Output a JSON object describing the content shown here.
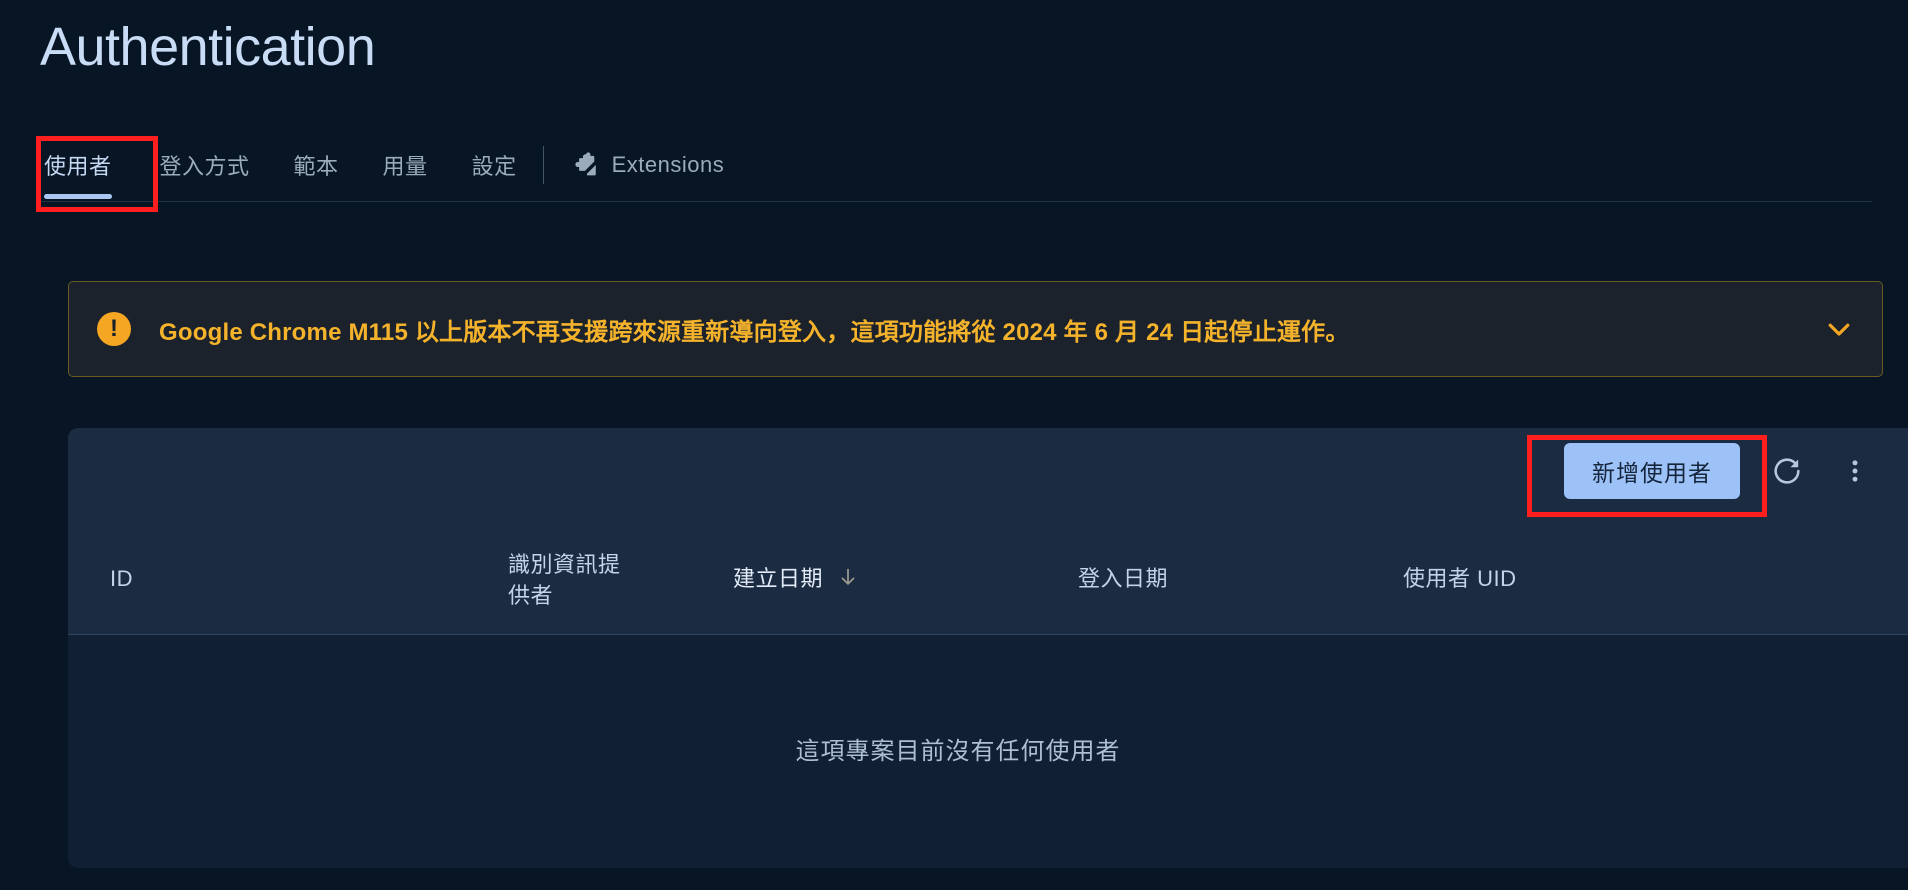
{
  "page": {
    "title": "Authentication",
    "accent_blue": "#9dc2f8",
    "warning_amber": "#f5b32c",
    "annotation_red": "#ff1f1f",
    "background": "#071524",
    "card_background": "#111f33",
    "card_header_background": "#1b2c42"
  },
  "tabs": [
    {
      "label": "使用者",
      "active": true,
      "icon": null
    },
    {
      "label": "登入方式",
      "active": false,
      "icon": null
    },
    {
      "label": "範本",
      "active": false,
      "icon": null
    },
    {
      "label": "用量",
      "active": false,
      "icon": null
    },
    {
      "label": "設定",
      "active": false,
      "icon": null
    },
    {
      "label": "Extensions",
      "active": false,
      "icon": "puzzle-piece-icon"
    }
  ],
  "banner": {
    "icon": "exclamation-circle-icon",
    "icon_glyph": "!",
    "message": "Google Chrome M115 以上版本不再支援跨來源重新導向登入，這項功能將從 2024 年 6 月 24 日起停止運作。",
    "expand_icon": "chevron-down-icon"
  },
  "toolbar": {
    "add_user_label": "新增使用者",
    "refresh_icon": "refresh-icon",
    "more_icon": "more-vert-icon"
  },
  "table": {
    "columns": [
      {
        "key": "id",
        "label": "ID",
        "sortable": false
      },
      {
        "key": "provider",
        "label": "識別資訊提供者",
        "sortable": false
      },
      {
        "key": "created",
        "label": "建立日期",
        "sortable": true,
        "sort_direction": "desc",
        "sort_icon": "arrow-down-icon"
      },
      {
        "key": "signin",
        "label": "登入日期",
        "sortable": false
      },
      {
        "key": "uid",
        "label": "使用者 UID",
        "sortable": false
      }
    ],
    "rows": [],
    "empty_message": "這項專案目前沒有任何使用者"
  }
}
